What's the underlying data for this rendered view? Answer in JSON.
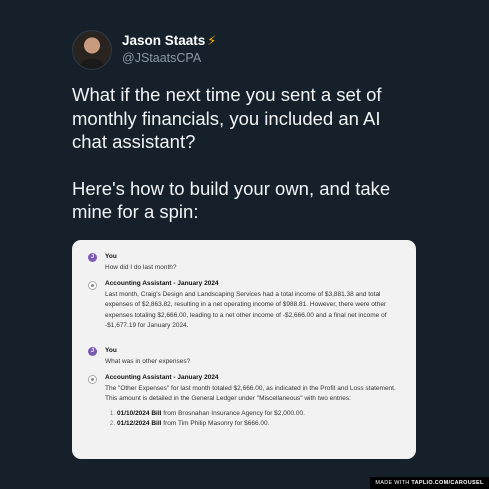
{
  "profile": {
    "name": "Jason Staats",
    "handle": "@JStaatsCPA",
    "badge_icon": "lightning-bolt-icon"
  },
  "tweet": {
    "paragraph1": "What if the next time you sent a set of\nmonthly financials, you included an AI\nchat assistant?",
    "paragraph2": "Here's how to build your own, and take\nmine for a spin:"
  },
  "chat": {
    "messages": [
      {
        "role": "user",
        "avatar_letter": "J",
        "author": "You",
        "text": "How did I do last month?"
      },
      {
        "role": "assistant",
        "author": "Accounting Assistant - January 2024",
        "text": "Last month, Craig's Design and Landscaping Services had a total income of $3,881.38 and total expenses of $2,863.82, resulting in a net operating income of $988.81. However, there were other expenses totaling $2,666.00, leading to a net other income of -$2,666.00 and a final net income of -$1,677.19 for January 2024."
      },
      {
        "role": "user",
        "avatar_letter": "J",
        "author": "You",
        "text": "What was in other expenses?"
      },
      {
        "role": "assistant",
        "author": "Accounting Assistant - January 2024",
        "text": "The \"Other Expenses\" for last month totaled $2,666.00, as indicated in the Profit and Loss statement. This amount is detailed in the General Ledger under \"Miscellaneous\" with two entries:",
        "list": [
          {
            "bold": "01/10/2024 Bill",
            "rest": " from Brosnahan Insurance Agency for $2,000.00."
          },
          {
            "bold": "01/12/2024 Bill",
            "rest": " from Tim Philip Masonry for $666.00."
          }
        ]
      }
    ]
  },
  "footer": {
    "made_with": "MADE WITH",
    "site": "TAPLIO.COM/CAROUSEL"
  },
  "colors": {
    "background": "#15202b",
    "card": "#f2f2f2",
    "user_avatar": "#7c5bb5",
    "bolt": "#f4b400"
  }
}
